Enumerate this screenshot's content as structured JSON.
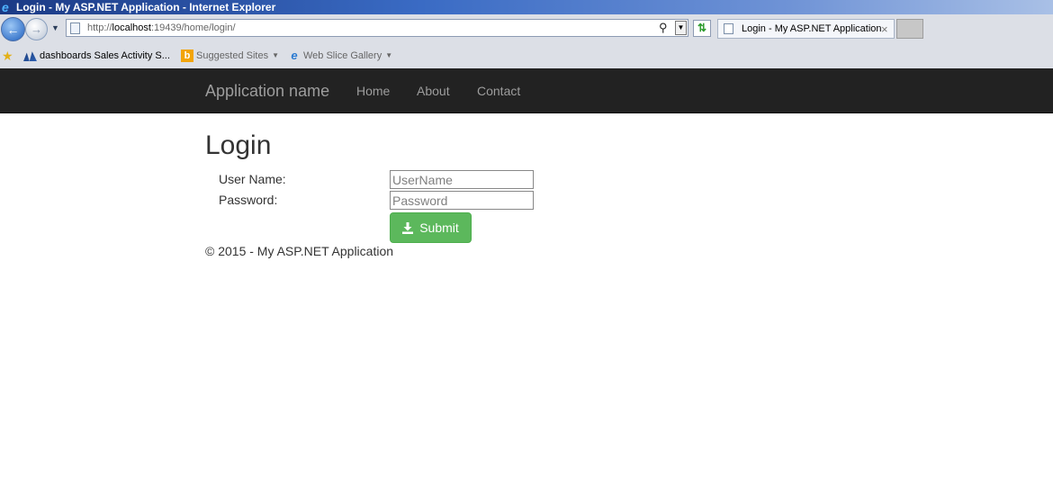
{
  "window": {
    "title": "Login - My ASP.NET Application - Internet Explorer"
  },
  "browser": {
    "url_prefix": "http://",
    "url_host": "localhost",
    "url_path": ":19439/home/login/",
    "tab_label": "Login - My ASP.NET Application",
    "tab_close": "×"
  },
  "favorites": [
    {
      "label": "dashboards Sales Activity S...",
      "icon": "dashboard-icon"
    },
    {
      "label": "Suggested Sites",
      "icon": "bing-icon"
    },
    {
      "label": "Web Slice Gallery",
      "icon": "ie-icon"
    }
  ],
  "site": {
    "brand": "Application name",
    "nav": [
      "Home",
      "About",
      "Contact"
    ]
  },
  "page": {
    "heading": "Login",
    "form": {
      "username_label": "User Name:",
      "username_placeholder": "UserName",
      "password_label": "Password:",
      "password_placeholder": "Password",
      "submit_label": "Submit"
    },
    "footer": "© 2015 - My ASP.NET Application"
  },
  "colors": {
    "navbar": "#222222",
    "submit": "#5cb85c"
  }
}
